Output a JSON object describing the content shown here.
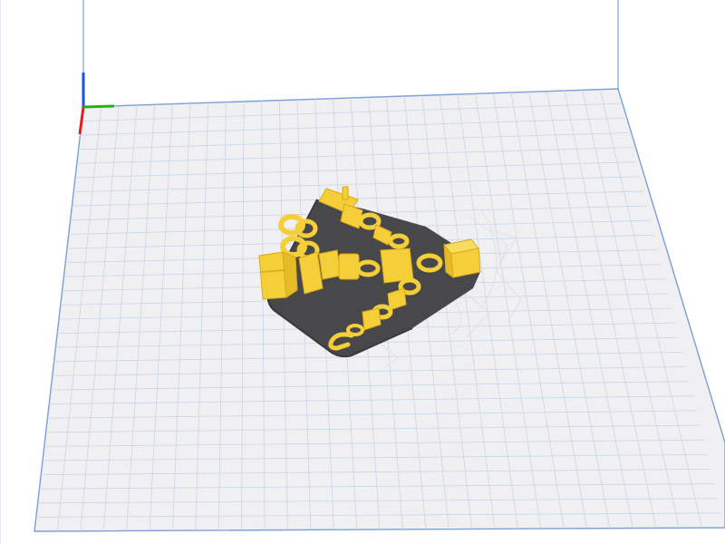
{
  "viewport": {
    "view": "build-plate-3d",
    "colors": {
      "background": "#ffffff",
      "plate": "#f0f0f2",
      "grid": "#c9d6e6",
      "plate_border": "#7a9fd6",
      "axis_x": "#e02020",
      "axis_y": "#20b020",
      "axis_z": "#2050e0",
      "model": "#f5cf3a",
      "model_shade": "#d8a918",
      "support_shadow": "#4a4a4c",
      "support_structure": "#e4e4e8"
    }
  },
  "model": {
    "name": "articulated-chain-figure",
    "color": "#f5cf3a",
    "selected": false
  },
  "axes": {
    "x": "axis-x",
    "y": "axis-y",
    "z": "axis-z"
  }
}
